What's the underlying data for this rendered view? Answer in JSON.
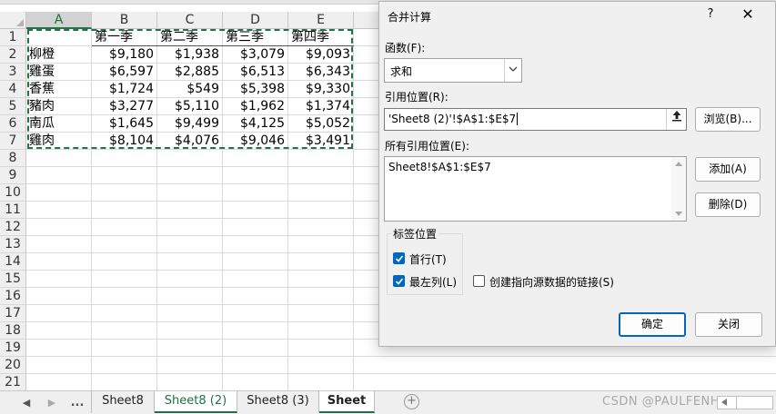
{
  "sheet": {
    "columns": [
      "A",
      "B",
      "C",
      "D",
      "E"
    ],
    "row_numbers": [
      "1",
      "2",
      "3",
      "4",
      "5",
      "6",
      "7",
      "8",
      "9",
      "10",
      "11",
      "12",
      "13",
      "14",
      "15",
      "16",
      "17",
      "18",
      "19",
      "20",
      "21"
    ],
    "header_row": [
      "",
      "第一季",
      "第二季",
      "第三季",
      "第四季"
    ],
    "rows": [
      [
        "柳橙",
        "$9,180",
        "$1,938",
        "$3,079",
        "$9,093"
      ],
      [
        "雞蛋",
        "$6,597",
        "$2,885",
        "$6,513",
        "$6,343"
      ],
      [
        "香蕉",
        "$1,724",
        "$549",
        "$5,398",
        "$9,330"
      ],
      [
        "豬肉",
        "$3,277",
        "$5,110",
        "$1,962",
        "$1,374"
      ],
      [
        "南瓜",
        "$1,645",
        "$9,499",
        "$4,125",
        "$5,052"
      ],
      [
        "雞肉",
        "$8,104",
        "$4,076",
        "$9,046",
        "$3,491"
      ]
    ],
    "selected_column": "A",
    "copy_range_color": "#217346"
  },
  "tabs": {
    "nav_prev": "◀",
    "nav_next": "▶",
    "more": "...",
    "items": [
      "Sheet8",
      "Sheet8 (2)",
      "Sheet8 (3)",
      "Sheet"
    ],
    "active": "Sheet8 (2)",
    "add_icon": "+",
    "watermark": "CSDN @PAULFENHUI"
  },
  "dialog": {
    "title": "合并计算",
    "help": "?",
    "close": "✕",
    "function_label": "函数(F):",
    "function_value": "求和",
    "reference_label": "引用位置(R):",
    "reference_value": "'Sheet8 (2)'!$A$1:$E$7",
    "browse_button": "浏览(B)...",
    "all_refs_label": "所有引用位置(E):",
    "all_refs": [
      "Sheet8!$A$1:$E$7"
    ],
    "add_button": "添加(A)",
    "delete_button": "删除(D)",
    "labels_group": "标签位置",
    "top_row": {
      "label": "首行(T)",
      "checked": true
    },
    "left_column": {
      "label": "最左列(L)",
      "checked": true
    },
    "link_source": {
      "label": "创建指向源数据的链接(S)",
      "checked": false
    },
    "ok_button": "确定",
    "close_button": "关闭",
    "accent_color": "#0067c0"
  }
}
